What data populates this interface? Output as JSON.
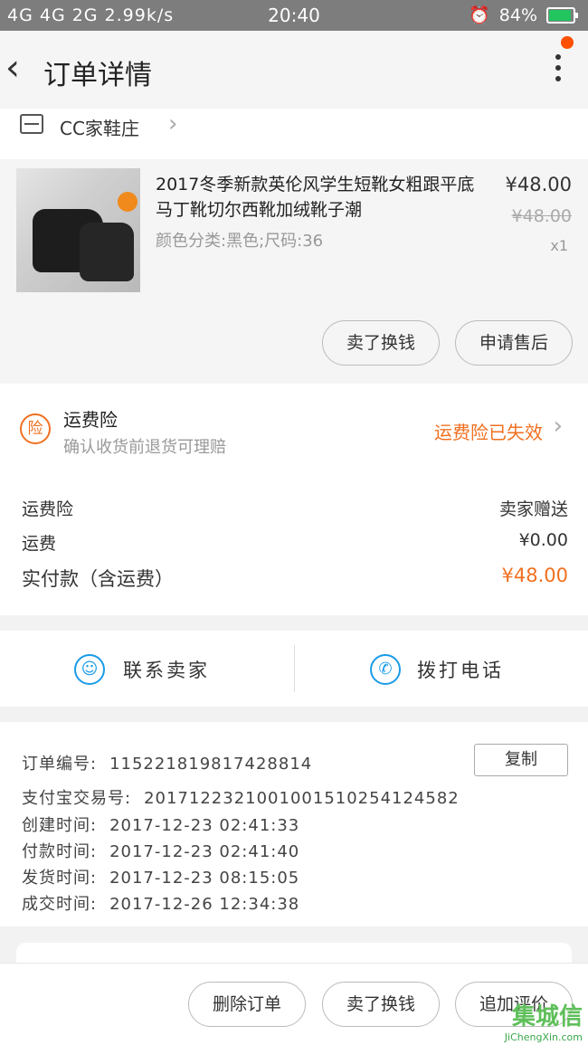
{
  "status_bar": {
    "signal": "4G 4G 2G 2.99k/s",
    "time": "20:40",
    "battery": "84%",
    "battery_level": 0.84
  },
  "header": {
    "title": "订单详情"
  },
  "shop": {
    "name": "CC家鞋庄"
  },
  "product": {
    "title": "2017冬季新款英伦风学生短靴女粗跟平底马丁靴切尔西靴加绒靴子潮",
    "sku": "颜色分类:黑色;尺码:36",
    "price": "¥48.00",
    "original_price": "¥48.00",
    "qty": "x1",
    "btn_exchange": "卖了换钱",
    "btn_aftersale": "申请售后"
  },
  "insurance": {
    "badge": "险",
    "title": "运费险",
    "subtitle": "确认收货前退货可理赔",
    "status": "运费险已失效",
    "status_color": "#f07020"
  },
  "fees": [
    {
      "label": "运费险",
      "value": "卖家赠送"
    },
    {
      "label": "运费",
      "value": "¥0.00"
    },
    {
      "label": "实付款（含运费）",
      "value": "¥48.00"
    }
  ],
  "contact": {
    "seller": "联系卖家",
    "call": "拨打电话"
  },
  "order_info": {
    "copy": "复制",
    "lines": [
      {
        "k": "订单编号:",
        "v": "115221819817428814"
      },
      {
        "k": "支付宝交易号:",
        "v": "20171223210010015102541245​82"
      },
      {
        "k": "创建时间:",
        "v": "2017-12-23 02:41:33"
      },
      {
        "k": "付款时间:",
        "v": "2017-12-23 02:41:40"
      },
      {
        "k": "发货时间:",
        "v": "2017-12-23 08:15:05"
      },
      {
        "k": "成交时间:",
        "v": "2017-12-26 12:34:38"
      }
    ]
  },
  "bottom": {
    "delete": "删除订单",
    "sell": "卖了换钱",
    "review": "追加评价"
  },
  "watermark": {
    "big": "集城信",
    "small": "JiChengXin.com"
  },
  "colors": {
    "accent": "#f07020",
    "contact_blue": "#1a9be8",
    "notify_dot": "#ff5000"
  }
}
